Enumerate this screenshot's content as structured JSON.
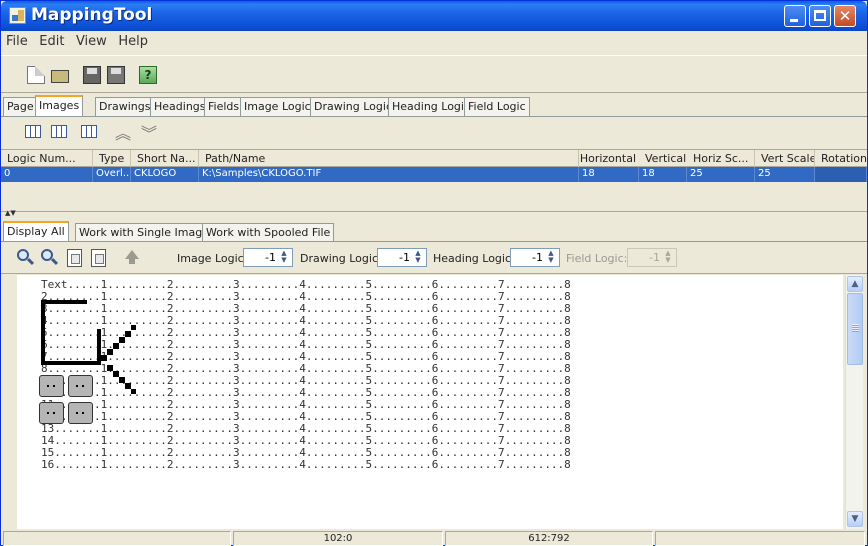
{
  "window": {
    "title": "MappingTool"
  },
  "menu": [
    "File",
    "Edit",
    "View",
    "Help"
  ],
  "toolbar": {
    "icons": [
      "new-document-icon",
      "open-folder-icon",
      "save-icon",
      "save-as-icon",
      "help-icon"
    ],
    "help_glyph": "?"
  },
  "tabs": [
    "Page",
    "Images",
    "Drawings",
    "Headings",
    "Fields",
    "Image Logic",
    "Drawing Logic",
    "Heading Logic",
    "Field Logic"
  ],
  "active_tab": "Images",
  "images_table": {
    "headers": [
      "Logic Num...",
      "Type",
      "Short Na...",
      "Path/Name",
      "Horizontal",
      "Vertical",
      "Horiz Sc...",
      "Vert Scale",
      "Rotation"
    ],
    "rows": [
      {
        "logic_num": "0",
        "type": "Overl...",
        "short_name": "CKLOGO",
        "path": "K:\\Samples\\CKLOGO.TIF",
        "horizontal": "18",
        "vertical": "18",
        "horiz_scale": "25",
        "vert_scale": "25",
        "rotation": ""
      }
    ]
  },
  "subtabs": [
    "Display All",
    "Work with Single Image",
    "Work with Spooled File"
  ],
  "active_subtab": "Display All",
  "display_toolbar": {
    "image_logic_label": "Image Logic:",
    "image_logic_value": "-1",
    "drawing_logic_label": "Drawing Logic:",
    "drawing_logic_value": "-1",
    "heading_logic_label": "Heading Logic:",
    "heading_logic_value": "-1",
    "field_logic_label": "Field Logic:",
    "field_logic_value": "-1",
    "spin_up": "▲",
    "spin_down": "▼"
  },
  "text_lines": [
    "Text.....1.........2.........3.........4.........5.........6.........7.........8",
    "2........1.........2.........3.........4.........5.........6.........7.........8",
    "3........1.........2.........3.........4.........5.........6.........7.........8",
    "4........1.........2.........3.........4.........5.........6.........7.........8",
    "5........1.........2.........3.........4.........5.........6.........7.........8",
    "6........1.........2.........3.........4.........5.........6.........7.........8",
    "7........1.........2.........3.........4.........5.........6.........7.........8",
    "8........1.........2.........3.........4.........5.........6.........7.........8",
    "9........1.........2.........3.........4.........5.........6.........7.........8",
    "10.......1.........2.........3.........4.........5.........6.........7.........8",
    "11.......1.........2.........3.........4.........5.........6.........7.........8",
    "12.......1.........2.........3.........4.........5.........6.........7.........8",
    "13.......1.........2.........3.........4.........5.........6.........7.........8",
    "14.......1.........2.........3.........4.........5.........6.........7.........8",
    "15.......1.........2.........3.........4.........5.........6.........7.........8",
    "16.......1.........2.........3.........4.........5.........6.........7.........8"
  ],
  "statusbar": {
    "cell1": "",
    "cell2": "102:0",
    "cell3": "612:792",
    "cell4": ""
  },
  "colors": {
    "titlebar": "#0A5FE6",
    "selection": "#316AC5",
    "tab_highlight": "#F6A424"
  }
}
